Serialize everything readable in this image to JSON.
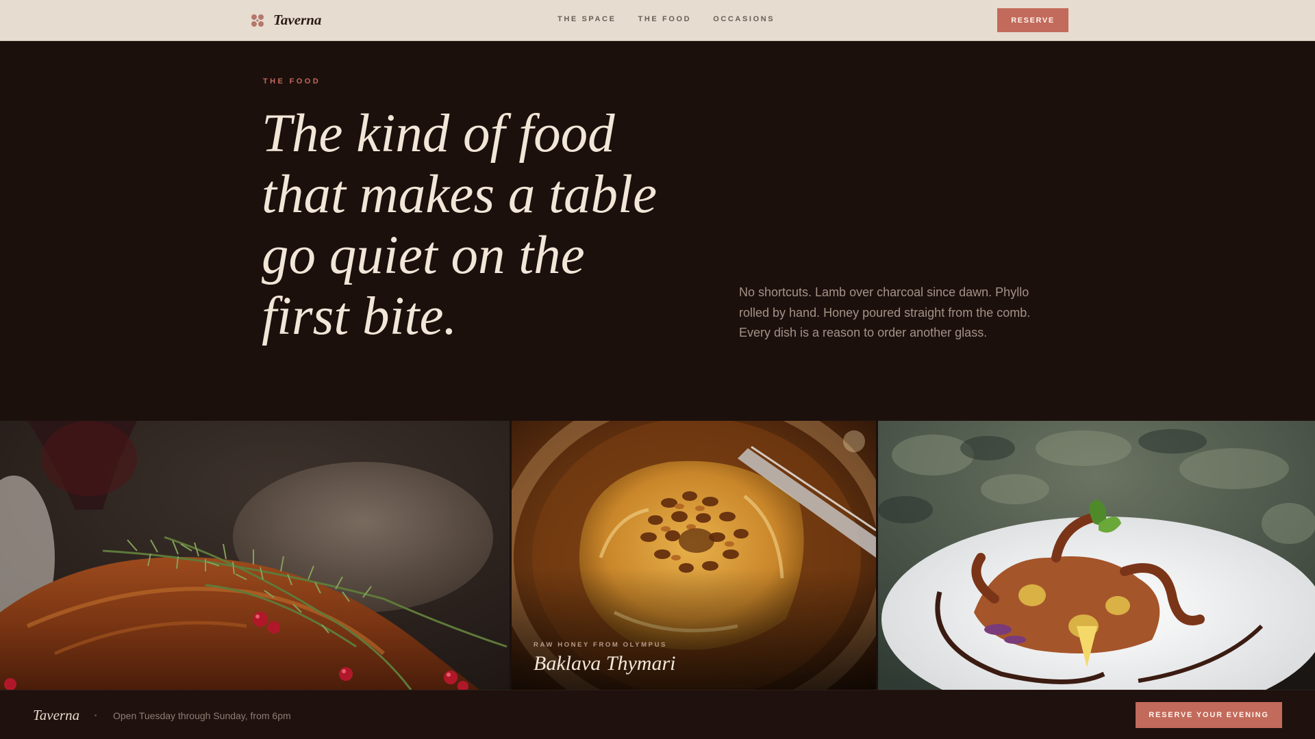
{
  "nav": {
    "brand": "Taverna",
    "brand_icon": "rosette-logo-icon",
    "links": [
      "THE SPACE",
      "THE FOOD",
      "OCCASIONS"
    ],
    "reserve_label": "RESERVE"
  },
  "hero": {
    "eyebrow": "THE FOOD",
    "headline": "The kind of food that makes a table go quiet on the first bite.",
    "lede": "No shortcuts. Lamb over charcoal since dawn. Phyllo rolled by hand. Honey poured straight from the comb. Every dish is a reason to order another glass."
  },
  "gallery": {
    "featured": {
      "kicker": "RAW HONEY FROM OLYMPUS",
      "title": "Baklava Thymari"
    }
  },
  "footer": {
    "brand": "Taverna",
    "hours": "Open Tuesday through Sunday, from 6pm",
    "cta_label": "RESERVE YOUR EVENING"
  },
  "colors": {
    "accent": "#c26a5b",
    "nav_bg": "#e6dccf",
    "page_bg": "#1c100d",
    "headline": "#f2e6d8"
  }
}
